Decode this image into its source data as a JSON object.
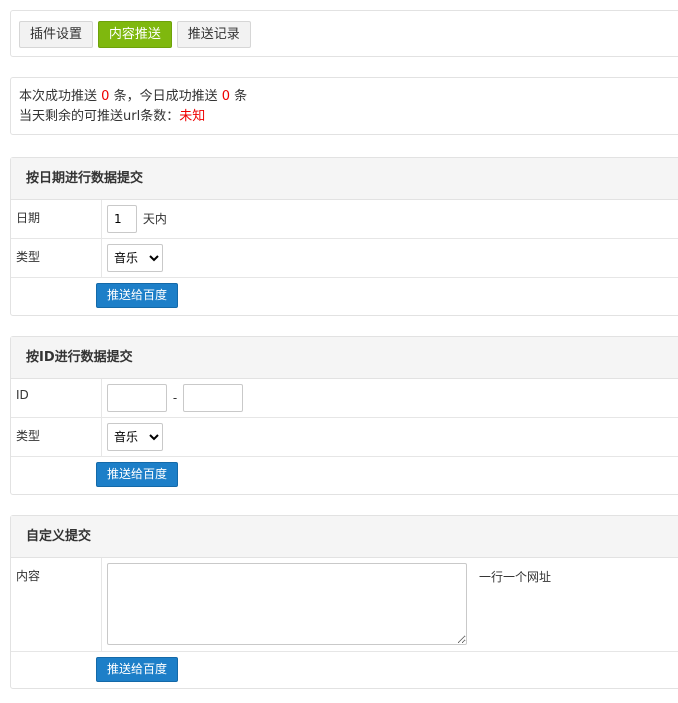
{
  "tabs": [
    {
      "label": "插件设置"
    },
    {
      "label": "内容推送"
    },
    {
      "label": "推送记录"
    }
  ],
  "info": {
    "line1_prefix": "本次成功推送",
    "success_count": "0",
    "line1_mid": "条，今日成功推送",
    "today_count": "0",
    "line1_suffix": "条",
    "line2_prefix": "当天剩余的可推送url条数：",
    "remaining": "未知"
  },
  "by_date": {
    "title": "按日期进行数据提交",
    "date_label": "日期",
    "days_value": "1",
    "days_unit": "天内",
    "type_label": "类型",
    "type_selected": "音乐",
    "submit": "推送给百度"
  },
  "by_id": {
    "title": "按ID进行数据提交",
    "id_label": "ID",
    "id_from": "",
    "separator": "-",
    "id_to": "",
    "type_label": "类型",
    "type_selected": "音乐",
    "submit": "推送给百度"
  },
  "custom": {
    "title": "自定义提交",
    "content_label": "内容",
    "content_value": "",
    "hint": "一行一个网址",
    "submit": "推送给百度"
  },
  "colors": {
    "active_tab": "#7fb80e",
    "button": "#1d7fc8",
    "highlight": "#e00000"
  }
}
